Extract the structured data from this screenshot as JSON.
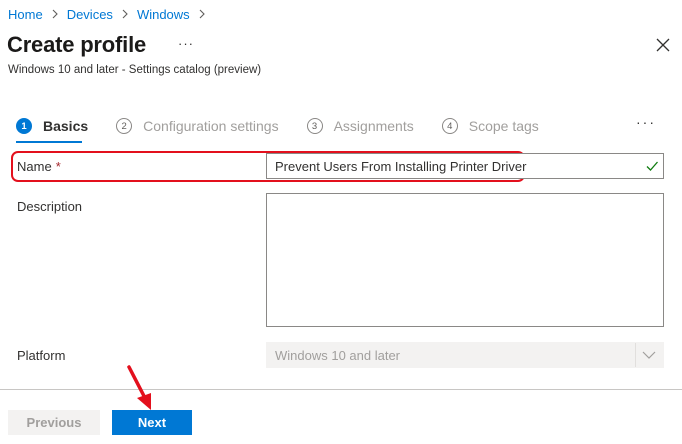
{
  "breadcrumb": {
    "items": [
      "Home",
      "Devices",
      "Windows"
    ]
  },
  "header": {
    "title": "Create profile",
    "more_label": "···",
    "subtitle": "Windows 10 and later - Settings catalog (preview)"
  },
  "wizard": {
    "steps": [
      {
        "number": "1",
        "label": "Basics",
        "state": "active"
      },
      {
        "number": "2",
        "label": "Configuration settings",
        "state": "inactive"
      },
      {
        "number": "3",
        "label": "Assignments",
        "state": "inactive"
      },
      {
        "number": "4",
        "label": "Scope tags",
        "state": "inactive"
      }
    ],
    "more_label": "···"
  },
  "form": {
    "name": {
      "label": "Name",
      "required_marker": "*",
      "value": "Prevent Users From Installing Printer Driver",
      "validation_icon": "checkmark-icon"
    },
    "description": {
      "label": "Description",
      "value": ""
    },
    "platform": {
      "label": "Platform",
      "value": "Windows 10 and later",
      "disabled": true
    }
  },
  "footer": {
    "previous_label": "Previous",
    "next_label": "Next"
  },
  "annotations": {
    "highlight_color": "#e3101d",
    "arrow_color": "#e3101d"
  },
  "colors": {
    "accent": "#0078d4",
    "success": "#107c10",
    "required": "#a4262c"
  }
}
